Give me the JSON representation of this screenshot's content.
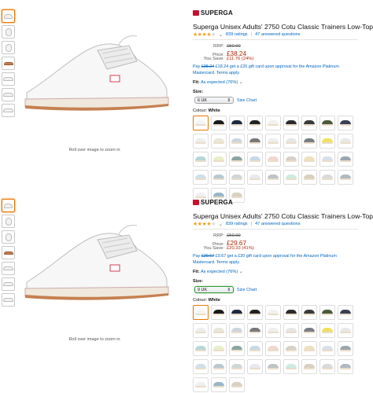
{
  "panels": [
    {
      "brand": "SUPERGA",
      "title": "Superga Unisex Adults' 2750 Cotu Classic Trainers Low-Top",
      "rating_count": "839 ratings",
      "answered": "47 answered questions",
      "rrp_label": "RRP:",
      "rrp_value": "£50.00",
      "price_label": "Price:",
      "price_value": "£38.24",
      "save_label": "You Save:",
      "save_value": "£11.76 (24%)",
      "promo_pay": "Pay",
      "promo_old": "£38.24",
      "promo_rest": "£18.24 get a £20 gift card upon approval for the Amazon Platinum Mastercard. Terms apply.",
      "fit_label": "Fit:",
      "fit_value": "As expected (76%)",
      "size_label": "Size:",
      "size_selected": "6 UK",
      "size_chart": "Size Chart",
      "colour_label": "Colour:",
      "colour_value": "White",
      "rollover": "Roll over image to zoom in"
    },
    {
      "brand": "SUPERGA",
      "title": "Superga Unisex Adults' 2750 Cotu Classic Trainers Low-Top",
      "rating_count": "839 ratings",
      "answered": "47 answered questions",
      "rrp_label": "RRP:",
      "rrp_value": "£50.00",
      "price_label": "Price:",
      "price_value": "£29.67",
      "save_label": "You Save:",
      "save_value": "£20.33 (41%)",
      "promo_pay": "Pay",
      "promo_old": "£29.67",
      "promo_rest": "£9.67 get a £20 gift card upon approval for the Amazon Platinum Mastercard. Terms apply.",
      "fit_label": "Fit:",
      "fit_value": "As expected (76%)",
      "size_label": "Size:",
      "size_selected": "9 UK",
      "size_chart": "Size Chart",
      "colour_label": "Colour:",
      "colour_value": "White",
      "rollover": "Roll over image to zoom in"
    }
  ],
  "colors": {
    "price_red": "#b12704",
    "link_blue": "#0066c0",
    "star_orange": "#f0a01e",
    "selected_orange": "#e77600",
    "brand_red": "#c8102e"
  },
  "swatch_colors": [
    "#f4f4f4",
    "#1a1a1a",
    "#1f2a3f",
    "#222222",
    "#f2f2f2",
    "#2b2b2b",
    "#3a3a3a",
    "#4b5a3a",
    "#3a3f55",
    "#eeeeee",
    "#e9e6da",
    "#ccd6dd",
    "#78787a",
    "#eeeeee",
    "#e6e6e6",
    "#7a7f86",
    "#f0e060",
    "#e8e8e8",
    "#b8d6d8",
    "#e8eec8",
    "#8aa6a0",
    "#c8d8e6",
    "#f0d8d0",
    "#d6d0c8",
    "#ede0c0",
    "#d8e0e8",
    "#9aa6b0",
    "#d0e0e8",
    "#b8c8d0",
    "#cfd6d8",
    "#e8e8f0",
    "#bcc4c6",
    "#cdeadf",
    "#d8d0c0",
    "#dadada",
    "#b0b8c0",
    "#f0f0f0",
    "#9ab6c8",
    "#d8d0c0"
  ]
}
